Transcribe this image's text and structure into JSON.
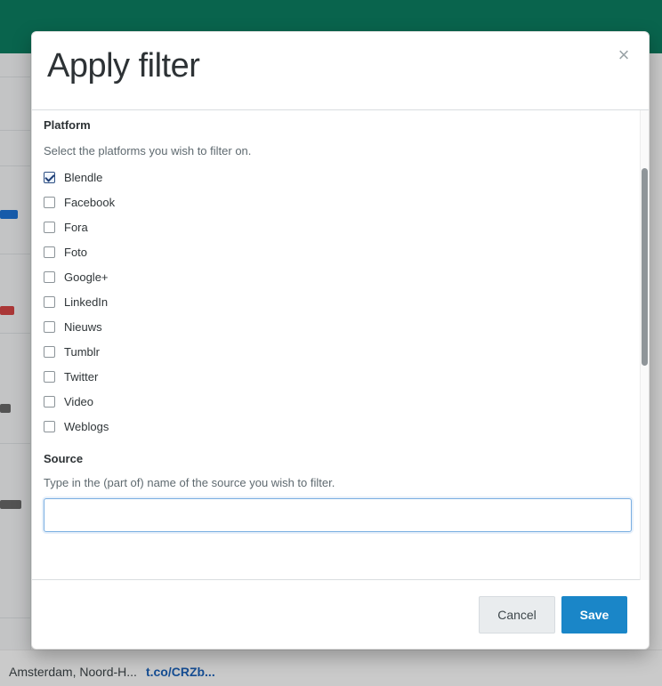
{
  "modal": {
    "title": "Apply filter",
    "close_label": "×",
    "platform": {
      "heading": "Platform",
      "help": "Select the platforms you wish to filter on.",
      "items": [
        {
          "label": "Blendle",
          "checked": true
        },
        {
          "label": "Facebook",
          "checked": false
        },
        {
          "label": "Fora",
          "checked": false
        },
        {
          "label": "Foto",
          "checked": false
        },
        {
          "label": "Google+",
          "checked": false
        },
        {
          "label": "LinkedIn",
          "checked": false
        },
        {
          "label": "Nieuws",
          "checked": false
        },
        {
          "label": "Tumblr",
          "checked": false
        },
        {
          "label": "Twitter",
          "checked": false
        },
        {
          "label": "Video",
          "checked": false
        },
        {
          "label": "Weblogs",
          "checked": false
        }
      ]
    },
    "source": {
      "heading": "Source",
      "help": "Type in the (part of) name of the source you wish to filter.",
      "value": "",
      "placeholder": ""
    },
    "buttons": {
      "cancel": "Cancel",
      "save": "Save"
    }
  },
  "background": {
    "footer_text": "Amsterdam, Noord-H...",
    "footer_link": "t.co/CRZb..."
  },
  "colors": {
    "teal": "#0b7a5e",
    "blue": "#1a86c8"
  }
}
